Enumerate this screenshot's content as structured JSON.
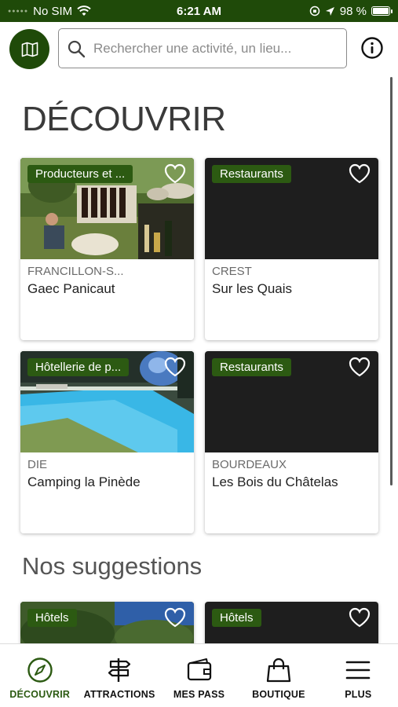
{
  "status_bar": {
    "carrier": "No SIM",
    "time": "6:21 AM",
    "battery": "98 %",
    "battery_level": 0.98
  },
  "header": {
    "search_placeholder": "Rechercher une activité, un lieu...",
    "map_icon": "map-icon",
    "info_icon": "info-icon"
  },
  "sections": {
    "discover_title": "DÉCOUVRIR",
    "suggestions_title": "Nos suggestions"
  },
  "discover_cards": [
    {
      "category": "Producteurs et ...",
      "town": "FRANCILLON-S...",
      "name": "Gaec Panicaut"
    },
    {
      "category": "Restaurants",
      "town": "CREST",
      "name": "Sur les Quais"
    },
    {
      "category": "Hôtellerie de p...",
      "town": "DIE",
      "name": "Camping la Pinède"
    },
    {
      "category": "Restaurants",
      "town": "BOURDEAUX",
      "name": "Les Bois du Châtelas"
    }
  ],
  "suggestion_cards": [
    {
      "category": "Hôtels"
    },
    {
      "category": "Hôtels"
    }
  ],
  "tabs": [
    {
      "label": "DÉCOUVRIR",
      "icon": "compass-icon",
      "active": true
    },
    {
      "label": "ATTRACTIONS",
      "icon": "signpost-icon",
      "active": false
    },
    {
      "label": "MES PASS",
      "icon": "wallet-icon",
      "active": false
    },
    {
      "label": "BOUTIQUE",
      "icon": "shopping-bag-icon",
      "active": false
    },
    {
      "label": "PLUS",
      "icon": "menu-icon",
      "active": false
    }
  ],
  "colors": {
    "brand_green": "#1f4a09",
    "badge_green": "#2c5a12"
  }
}
